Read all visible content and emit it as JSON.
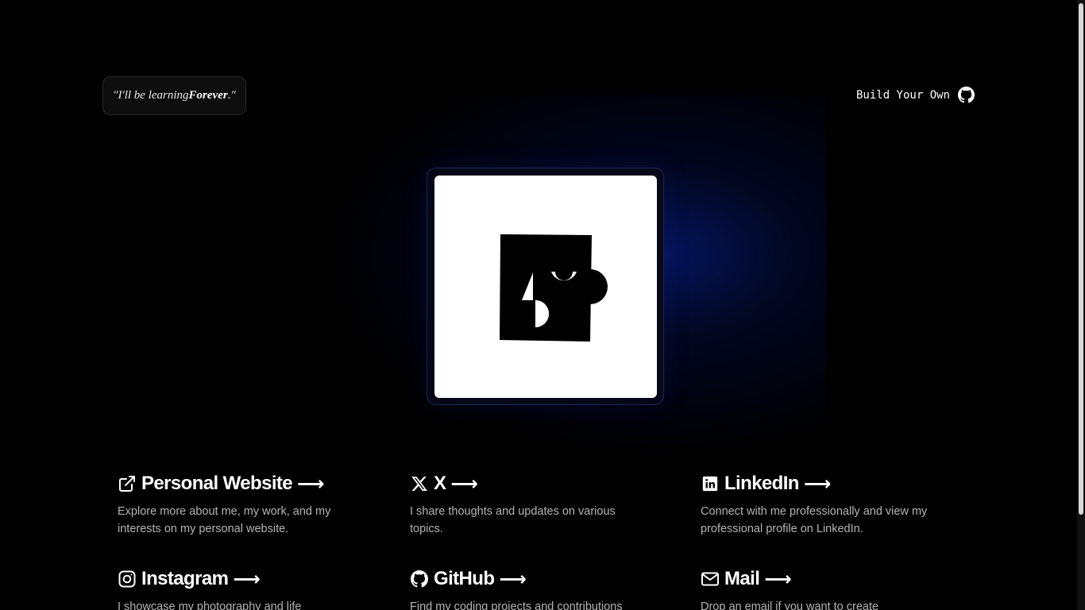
{
  "header": {
    "quote_prefix": "\"I'll be learning ",
    "quote_emphasis": "Forever",
    "quote_suffix": ".\"",
    "build_link_label": "Build Your Own"
  },
  "links": [
    {
      "icon": "external-link-icon",
      "title": "Personal Website",
      "arrow": "⟶",
      "description": "Explore more about me, my work, and my interests on my personal website."
    },
    {
      "icon": "x-logo-icon",
      "title": "X",
      "arrow": "⟶",
      "description": "I share thoughts and updates on various topics."
    },
    {
      "icon": "linkedin-icon",
      "title": "LinkedIn",
      "arrow": "⟶",
      "description": "Connect with me professionally and view my professional profile on LinkedIn."
    },
    {
      "icon": "instagram-icon",
      "title": "Instagram",
      "arrow": "⟶",
      "description": "I showcase my photography and life"
    },
    {
      "icon": "github-icon",
      "title": "GitHub",
      "arrow": "⟶",
      "description": "Find my coding projects and contributions"
    },
    {
      "icon": "mail-icon",
      "title": "Mail",
      "arrow": "⟶",
      "description": "Drop an email if you want to create"
    }
  ],
  "colors": {
    "background": "#000000",
    "glow": "#06186e",
    "text": "#ffffff",
    "muted_text": "#b4b4b4"
  }
}
